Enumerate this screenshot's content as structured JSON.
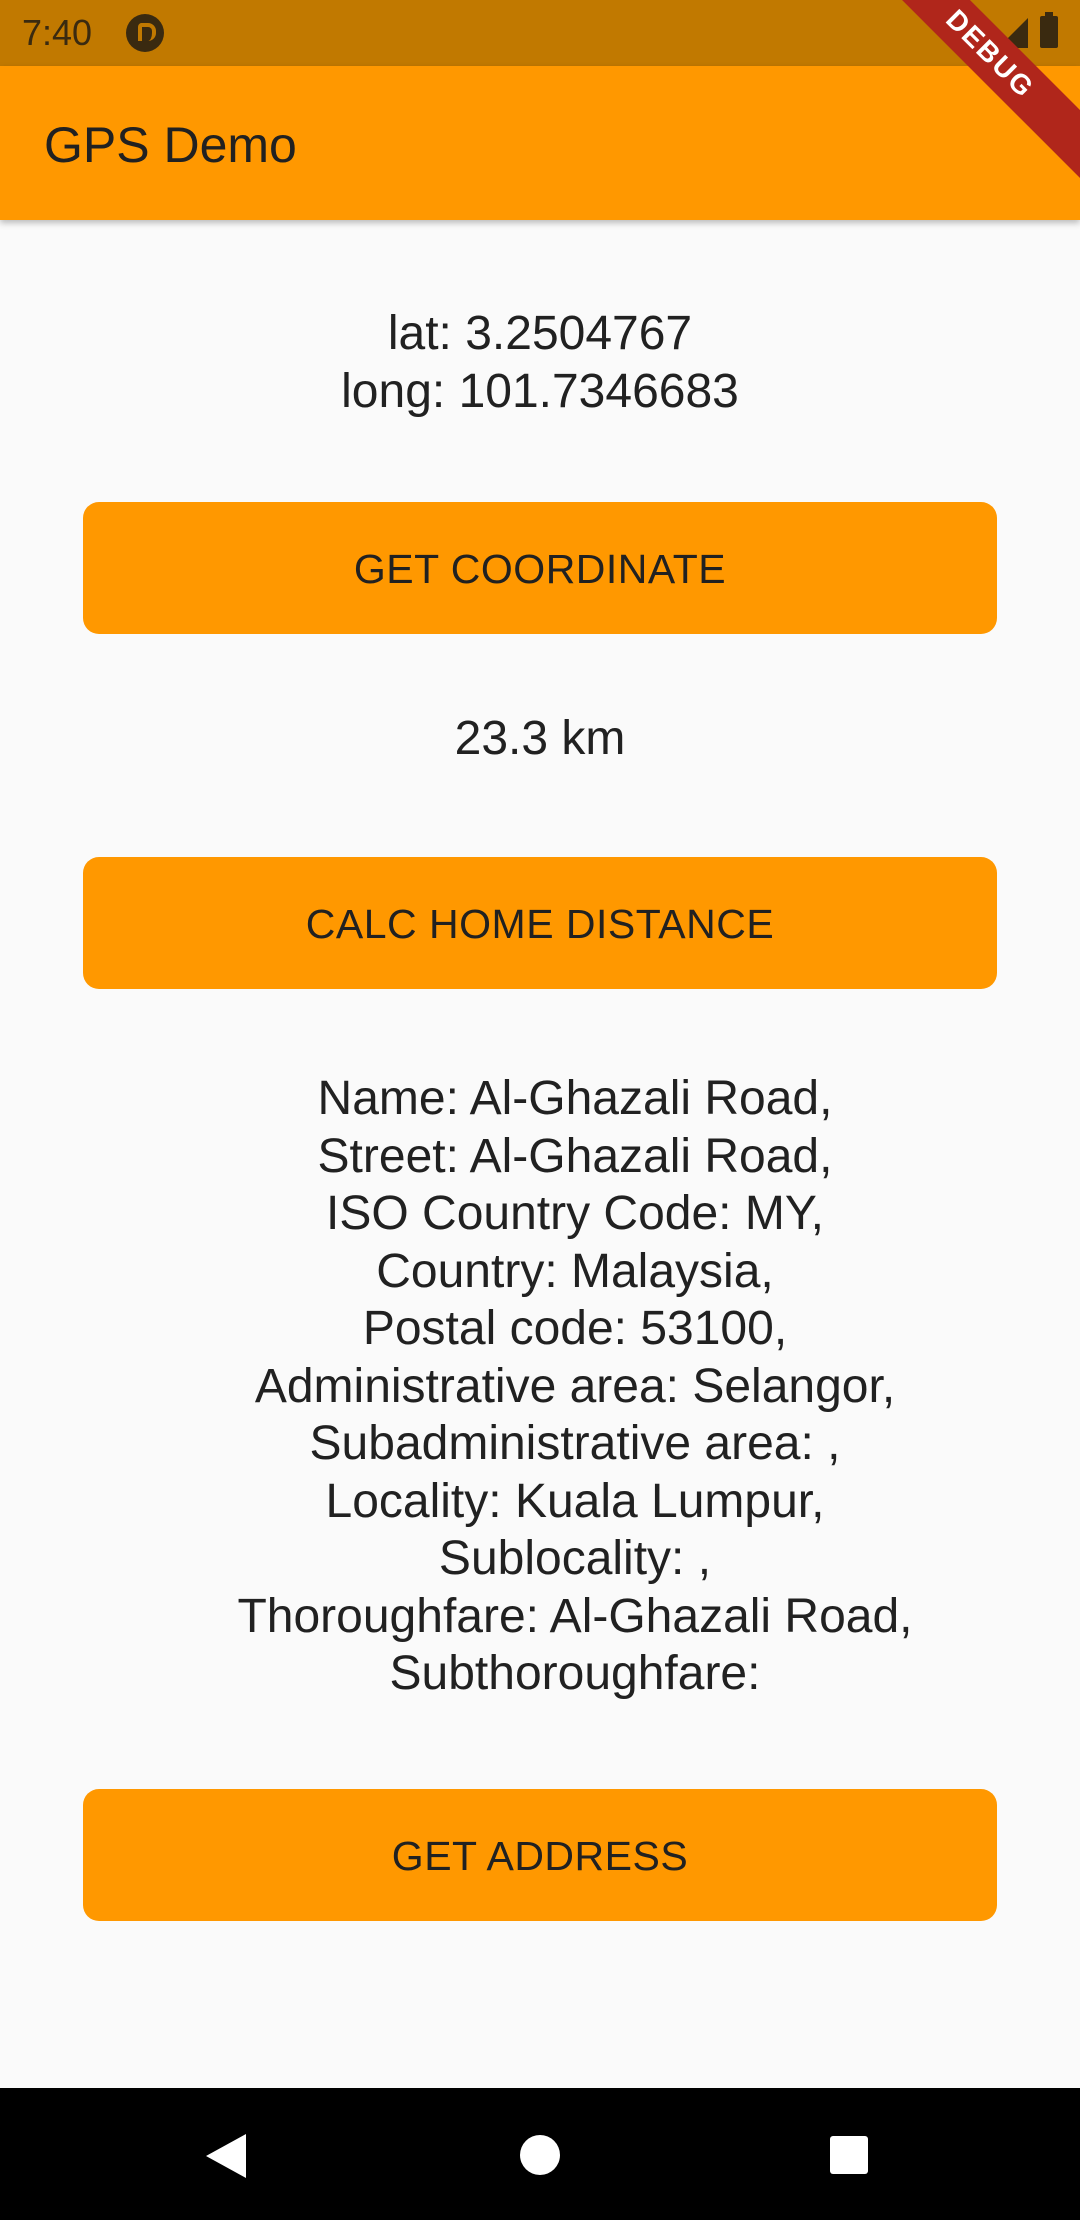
{
  "status_bar": {
    "time": "7:40",
    "icons": [
      "app-notification-icon",
      "wifi-icon",
      "signal-icon",
      "battery-icon"
    ]
  },
  "app_bar": {
    "title": "GPS Demo",
    "debug_banner": "DEBUG",
    "color": "#ff9800"
  },
  "coordinates": {
    "lat": "lat: 3.2504767",
    "long": "long: 101.7346683"
  },
  "buttons": {
    "get_coordinate": "GET COORDINATE",
    "calc_home_distance": "CALC HOME DISTANCE",
    "get_address": "GET ADDRESS"
  },
  "distance": "23.3 km",
  "address_lines": [
    "Name: Al-Ghazali Road,",
    "Street: Al-Ghazali Road,",
    "ISO Country Code: MY,",
    "Country: Malaysia,",
    "Postal code: 53100,",
    "Administrative area: Selangor,",
    "Subadministrative area: ,",
    "Locality: Kuala Lumpur,",
    "Sublocality: ,",
    "Thoroughfare: Al-Ghazali Road,",
    "Subthoroughfare:"
  ],
  "nav_bar": {
    "icons": [
      "back-icon",
      "home-icon",
      "recents-icon"
    ]
  }
}
